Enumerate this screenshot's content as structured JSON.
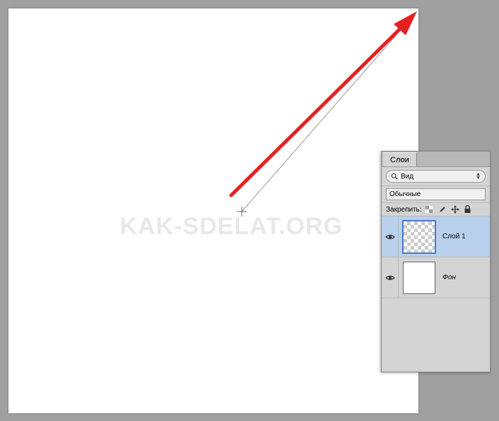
{
  "canvas": {
    "watermark": "KAK-SDELAT.ORG"
  },
  "layersPanel": {
    "tabTitle": "Слои",
    "filterLabel": "Вид",
    "blendMode": "Обычные",
    "lockLabel": "Закрепить:",
    "layers": [
      {
        "name": "Слой 1",
        "visible": true,
        "selected": true,
        "transparent": true,
        "italic": false
      },
      {
        "name": "Фон",
        "visible": true,
        "selected": false,
        "transparent": false,
        "italic": true
      }
    ]
  }
}
